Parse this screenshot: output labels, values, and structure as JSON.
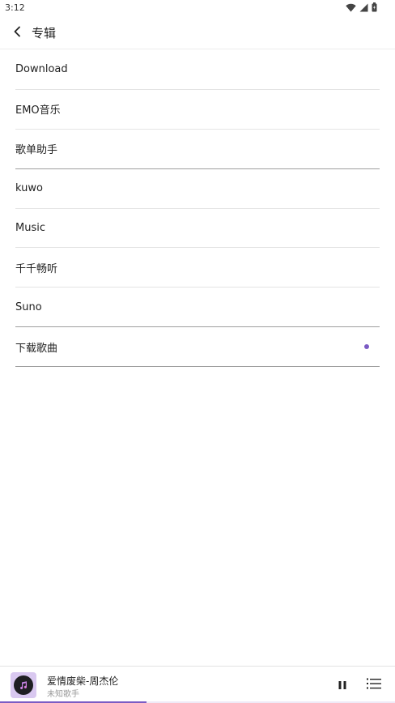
{
  "status_bar": {
    "time": "3:12",
    "icons": [
      "wifi-icon",
      "cellular-signal-icon",
      "battery-icon"
    ]
  },
  "header": {
    "back_icon": "chevron-left-icon",
    "title": "专辑"
  },
  "albums": [
    {
      "label": "Download",
      "selected": false
    },
    {
      "label": "EMO音乐",
      "selected": false
    },
    {
      "label": "歌单助手",
      "selected": false
    },
    {
      "label": "kuwo",
      "selected": false
    },
    {
      "label": "Music",
      "selected": false
    },
    {
      "label": "千千畅听",
      "selected": false
    },
    {
      "label": "Suno",
      "selected": false
    },
    {
      "label": "下载歌曲",
      "selected": true
    }
  ],
  "player": {
    "title": "爱情废柴-周杰伦",
    "artist": "未知歌手",
    "cover_icon": "music-note-icon",
    "pause_icon": "pause-icon",
    "playlist_icon": "playlist-icon",
    "progress": 0.37
  },
  "colors": {
    "accent": "#7b5bc4",
    "cover_bg": "#d9c8f0"
  }
}
